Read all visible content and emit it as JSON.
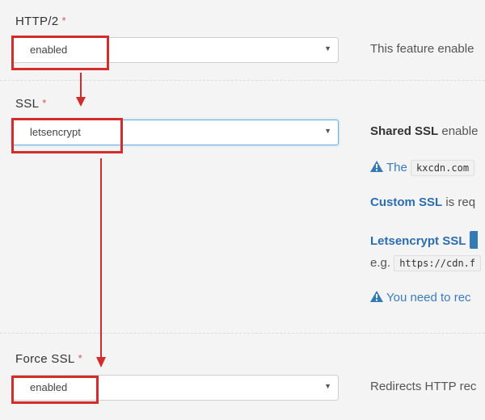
{
  "http2": {
    "label": "HTTP/2",
    "required_mark": "*",
    "value": "enabled",
    "help": "This feature enable"
  },
  "ssl": {
    "label": "SSL",
    "required_mark": "*",
    "value": "letsencrypt",
    "help_shared_title": "Shared SSL",
    "help_shared_rest": " enable",
    "warn_the": "The",
    "domain_code": "kxcdn.com",
    "custom_ssl_link": "Custom SSL",
    "custom_ssl_rest": " is req",
    "letsencrypt_link": "Letsencrypt SSL",
    "eg_prefix": "e.g.",
    "eg_code": "https://cdn.f",
    "warn_need": "You need to rec"
  },
  "force_ssl": {
    "label": "Force SSL",
    "required_mark": "*",
    "value": "enabled",
    "help": "Redirects HTTP rec"
  },
  "icons": {
    "dropdown": "caret-down-icon",
    "warning": "warning-triangle-icon"
  },
  "colors": {
    "annotation_red": "#d42b2b",
    "link_blue": "#2a6db3",
    "focus_blue": "#66afe9",
    "required_red": "#d9534f"
  }
}
